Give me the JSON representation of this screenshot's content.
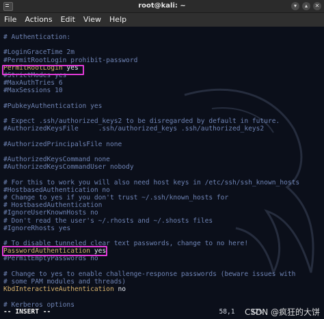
{
  "window": {
    "title": "root@kali: ~",
    "controls": [
      "minimize",
      "maximize",
      "close"
    ]
  },
  "menu": [
    "File",
    "Actions",
    "Edit",
    "View",
    "Help"
  ],
  "editor": {
    "lines": [
      {
        "text": "# Authentication:",
        "kind": "comment"
      },
      {
        "text": "",
        "kind": "blank"
      },
      {
        "text": "#LoginGraceTime 2m",
        "kind": "comment"
      },
      {
        "text": "#PermitRootLogin prohibit-password",
        "kind": "comment"
      },
      {
        "key": "PermitRootLogin",
        "value": " yes",
        "kind": "active"
      },
      {
        "text": "#StrictModes yes",
        "kind": "comment"
      },
      {
        "text": "#MaxAuthTries 6",
        "kind": "comment"
      },
      {
        "text": "#MaxSessions 10",
        "kind": "comment"
      },
      {
        "text": "",
        "kind": "blank"
      },
      {
        "text": "#PubkeyAuthentication yes",
        "kind": "comment"
      },
      {
        "text": "",
        "kind": "blank"
      },
      {
        "text": "# Expect .ssh/authorized_keys2 to be disregarded by default in future.",
        "kind": "comment"
      },
      {
        "text": "#AuthorizedKeysFile     .ssh/authorized_keys .ssh/authorized_keys2",
        "kind": "comment"
      },
      {
        "text": "",
        "kind": "blank"
      },
      {
        "text": "#AuthorizedPrincipalsFile none",
        "kind": "comment"
      },
      {
        "text": "",
        "kind": "blank"
      },
      {
        "text": "#AuthorizedKeysCommand none",
        "kind": "comment"
      },
      {
        "text": "#AuthorizedKeysCommandUser nobody",
        "kind": "comment"
      },
      {
        "text": "",
        "kind": "blank"
      },
      {
        "text": "# For this to work you will also need host keys in /etc/ssh/ssh_known_hosts",
        "kind": "comment"
      },
      {
        "text": "#HostbasedAuthentication no",
        "kind": "comment"
      },
      {
        "text": "# Change to yes if you don't trust ~/.ssh/known_hosts for",
        "kind": "comment"
      },
      {
        "text": "# HostbasedAuthentication",
        "kind": "comment"
      },
      {
        "text": "#IgnoreUserKnownHosts no",
        "kind": "comment"
      },
      {
        "text": "# Don't read the user's ~/.rhosts and ~/.shosts files",
        "kind": "comment"
      },
      {
        "text": "#IgnoreRhosts yes",
        "kind": "comment"
      },
      {
        "text": "",
        "kind": "blank"
      },
      {
        "text": "# To disable tunneled clear text passwords, change to no here!",
        "kind": "comment"
      },
      {
        "key": "PasswordAuthentication",
        "value": " yes",
        "kind": "active"
      },
      {
        "text": "#PermitEmptyPasswords no",
        "kind": "comment"
      },
      {
        "text": "",
        "kind": "blank"
      },
      {
        "text": "# Change to yes to enable challenge-response passwords (beware issues with",
        "kind": "comment"
      },
      {
        "text": "# some PAM modules and threads)",
        "kind": "comment"
      },
      {
        "key": "KbdInteractiveAuthentication",
        "value": " no",
        "kind": "active"
      },
      {
        "text": "",
        "kind": "blank"
      },
      {
        "text": "# Kerberos options",
        "kind": "comment"
      }
    ],
    "mode": "-- INSERT --",
    "position": "58,1",
    "percent": "32%"
  },
  "watermark": "CSDN @疯狂的大饼",
  "colors": {
    "background": "#0b0f1a",
    "comment": "#6f84b5",
    "key": "#d9b36c",
    "highlight": "#e23ad8"
  }
}
